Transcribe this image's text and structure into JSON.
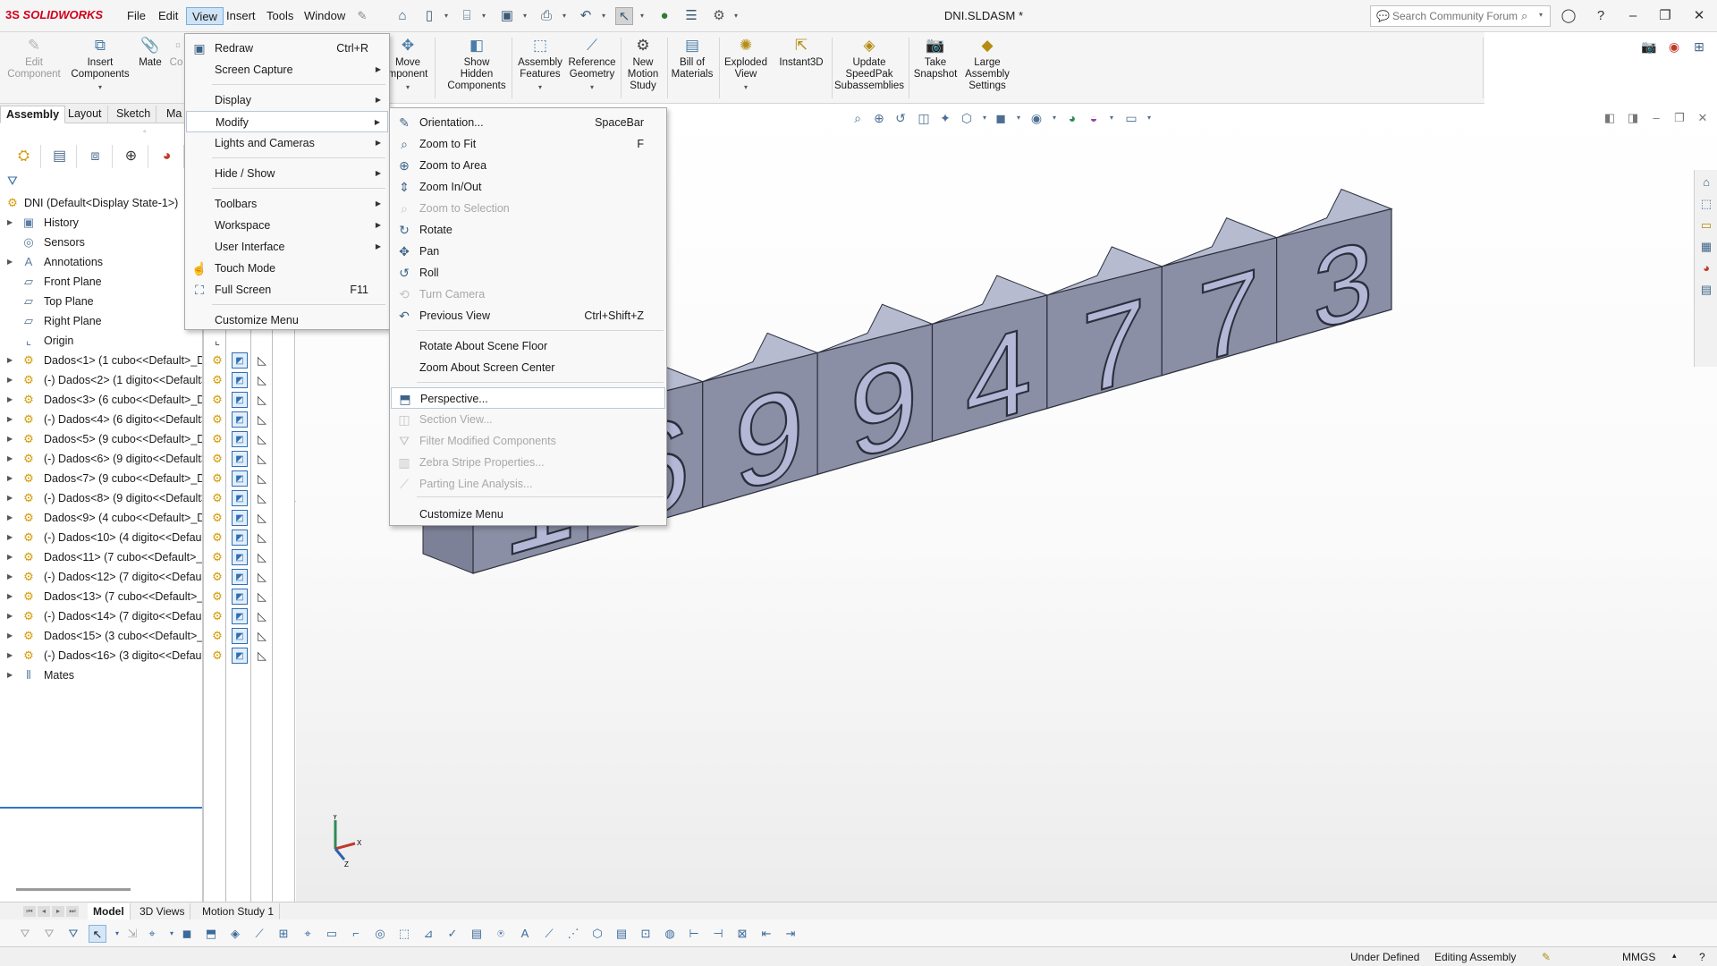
{
  "app": {
    "logo_prefix": "3S",
    "logo_name": "SOLIDWORKS",
    "document_title": "DNI.SLDASM *",
    "pin_icon": "pin-icon"
  },
  "menubar": [
    "File",
    "Edit",
    "View",
    "Insert",
    "Tools",
    "Window"
  ],
  "search": {
    "placeholder": "Search Community Forum"
  },
  "command_manager": [
    {
      "line1": "Edit",
      "line2": "Component",
      "icon": "edit-component-icon",
      "enabled": false
    },
    {
      "line1": "Insert",
      "line2": "Components",
      "icon": "insert-components-icon",
      "enabled": true
    },
    {
      "line1": "Mate",
      "line2": "",
      "icon": "mate-icon",
      "enabled": true
    },
    {
      "line1": "Co",
      "line2": "Co",
      "icon": "component-icon",
      "enabled": false
    },
    {
      "line1": "Move",
      "line2": "mponent",
      "icon": "move-component-icon",
      "enabled": true
    },
    {
      "line1": "Show",
      "line2": "Hidden",
      "line3": "Components",
      "icon": "show-hidden-icon",
      "enabled": true
    },
    {
      "line1": "Assembly",
      "line2": "Features",
      "icon": "assembly-features-icon",
      "enabled": true
    },
    {
      "line1": "Reference",
      "line2": "Geometry",
      "icon": "reference-geometry-icon",
      "enabled": true
    },
    {
      "line1": "New",
      "line2": "Motion",
      "line3": "Study",
      "icon": "motion-study-icon",
      "enabled": true
    },
    {
      "line1": "Bill of",
      "line2": "Materials",
      "icon": "bom-icon",
      "enabled": true
    },
    {
      "line1": "Exploded",
      "line2": "View",
      "icon": "exploded-view-icon",
      "enabled": true
    },
    {
      "line1": "Instant3D",
      "line2": "",
      "icon": "instant3d-icon",
      "enabled": true
    },
    {
      "line1": "Update",
      "line2": "SpeedPak",
      "line3": "Subassemblies",
      "icon": "speedpak-icon",
      "enabled": true
    },
    {
      "line1": "Take",
      "line2": "Snapshot",
      "icon": "snapshot-icon",
      "enabled": true
    },
    {
      "line1": "Large",
      "line2": "Assembly",
      "line3": "Settings",
      "icon": "large-assembly-icon",
      "enabled": true
    }
  ],
  "cm_tabs": [
    "Assembly",
    "Layout",
    "Sketch",
    "Ma"
  ],
  "tree": {
    "root": "DNI  (Default<Display State-1>)",
    "items": [
      {
        "label": "History",
        "icon": "history-folder-icon",
        "expand": true
      },
      {
        "label": "Sensors",
        "icon": "sensors-folder-icon",
        "expand": false
      },
      {
        "label": "Annotations",
        "icon": "annotations-folder-icon",
        "expand": true
      },
      {
        "label": "Front Plane",
        "icon": "plane-icon",
        "expand": false
      },
      {
        "label": "Top Plane",
        "icon": "plane-icon",
        "expand": false
      },
      {
        "label": "Right Plane",
        "icon": "plane-icon",
        "expand": false
      },
      {
        "label": "Origin",
        "icon": "origin-icon",
        "expand": false
      },
      {
        "label": "Dados<1> (1 cubo<<Default>_Di",
        "icon": "part-icon",
        "expand": true
      },
      {
        "label": "(-) Dados<2> (1 digito<<Default>",
        "icon": "part-icon",
        "expand": true
      },
      {
        "label": "Dados<3> (6 cubo<<Default>_Di",
        "icon": "part-icon",
        "expand": true
      },
      {
        "label": "(-) Dados<4> (6 digito<<Default>",
        "icon": "part-icon",
        "expand": true
      },
      {
        "label": "Dados<5> (9 cubo<<Default>_Di",
        "icon": "part-icon",
        "expand": true
      },
      {
        "label": "(-) Dados<6> (9 digito<<Default>",
        "icon": "part-icon",
        "expand": true
      },
      {
        "label": "Dados<7> (9 cubo<<Default>_Di",
        "icon": "part-icon",
        "expand": true
      },
      {
        "label": "(-) Dados<8> (9 digito<<Default>",
        "icon": "part-icon",
        "expand": true
      },
      {
        "label": "Dados<9> (4 cubo<<Default>_Di",
        "icon": "part-icon",
        "expand": true
      },
      {
        "label": "(-) Dados<10> (4 digito<<Default",
        "icon": "part-icon",
        "expand": true
      },
      {
        "label": "Dados<11> (7 cubo<<Default>_D",
        "icon": "part-icon",
        "expand": true
      },
      {
        "label": "(-) Dados<12> (7 digito<<Default",
        "icon": "part-icon",
        "expand": true
      },
      {
        "label": "Dados<13> (7 cubo<<Default>_D",
        "icon": "part-icon",
        "expand": true
      },
      {
        "label": "(-) Dados<14> (7 digito<<Default",
        "icon": "part-icon",
        "expand": true
      },
      {
        "label": "Dados<15> (3 cubo<<Default>_D",
        "icon": "part-icon",
        "expand": true
      },
      {
        "label": "(-) Dados<16> (3 digito<<Default",
        "icon": "part-icon",
        "expand": true
      },
      {
        "label": "Mates",
        "icon": "mates-icon",
        "expand": true
      }
    ]
  },
  "model": {
    "digits": [
      "1",
      "6",
      "9",
      "9",
      "4",
      "7",
      "7",
      "3"
    ],
    "block_color": "#8b8fa5",
    "block_top_color": "#b7bbd0",
    "digit_color": "#b4b8d6"
  },
  "view_menu": [
    {
      "label": "Redraw",
      "shortcut": "Ctrl+R",
      "icon": "redraw-icon",
      "submenu": false
    },
    {
      "label": "Screen Capture",
      "shortcut": "",
      "icon": "",
      "submenu": true
    },
    {
      "label": "Display",
      "shortcut": "",
      "icon": "",
      "submenu": true
    },
    {
      "label": "Modify",
      "shortcut": "",
      "icon": "",
      "submenu": true,
      "highlighted": true
    },
    {
      "label": "Lights and Cameras",
      "shortcut": "",
      "icon": "",
      "submenu": true
    },
    {
      "label": "Hide / Show",
      "shortcut": "",
      "icon": "",
      "submenu": true
    },
    {
      "label": "Toolbars",
      "shortcut": "",
      "icon": "",
      "submenu": true
    },
    {
      "label": "Workspace",
      "shortcut": "",
      "icon": "",
      "submenu": true
    },
    {
      "label": "User Interface",
      "shortcut": "",
      "icon": "",
      "submenu": true
    },
    {
      "label": "Touch Mode",
      "shortcut": "",
      "icon": "touch-mode-icon",
      "submenu": false
    },
    {
      "label": "Full Screen",
      "shortcut": "F11",
      "icon": "full-screen-icon",
      "submenu": false
    },
    {
      "label": "Customize Menu",
      "shortcut": "",
      "icon": "",
      "submenu": false
    }
  ],
  "modify_menu": [
    {
      "label": "Orientation...",
      "shortcut": "SpaceBar",
      "icon": "orientation-icon",
      "enabled": true
    },
    {
      "label": "Zoom to Fit",
      "shortcut": "F",
      "icon": "zoom-to-fit-icon",
      "enabled": true
    },
    {
      "label": "Zoom to Area",
      "shortcut": "",
      "icon": "zoom-to-area-icon",
      "enabled": true
    },
    {
      "label": "Zoom In/Out",
      "shortcut": "",
      "icon": "zoom-in-out-icon",
      "enabled": true
    },
    {
      "label": "Zoom to Selection",
      "shortcut": "",
      "icon": "zoom-to-selection-icon",
      "enabled": false
    },
    {
      "label": "Rotate",
      "shortcut": "",
      "icon": "rotate-icon",
      "enabled": true
    },
    {
      "label": "Pan",
      "shortcut": "",
      "icon": "pan-icon",
      "enabled": true
    },
    {
      "label": "Roll",
      "shortcut": "",
      "icon": "roll-icon",
      "enabled": true
    },
    {
      "label": "Turn Camera",
      "shortcut": "",
      "icon": "turn-camera-icon",
      "enabled": false
    },
    {
      "label": "Previous View",
      "shortcut": "Ctrl+Shift+Z",
      "icon": "previous-view-icon",
      "enabled": true
    },
    {
      "label": "Rotate About Scene Floor",
      "shortcut": "",
      "icon": "",
      "enabled": true
    },
    {
      "label": "Zoom About Screen Center",
      "shortcut": "",
      "icon": "",
      "enabled": true
    },
    {
      "label": "Perspective...",
      "shortcut": "",
      "icon": "perspective-icon",
      "enabled": true,
      "highlighted": true
    },
    {
      "label": "Section View...",
      "shortcut": "",
      "icon": "section-view-icon",
      "enabled": false
    },
    {
      "label": "Filter Modified Components",
      "shortcut": "",
      "icon": "filter-modified-icon",
      "enabled": false
    },
    {
      "label": "Zebra Stripe Properties...",
      "shortcut": "",
      "icon": "zebra-stripe-icon",
      "enabled": false
    },
    {
      "label": "Parting Line Analysis...",
      "shortcut": "",
      "icon": "parting-line-icon",
      "enabled": false
    },
    {
      "label": "Customize Menu",
      "shortcut": "",
      "icon": "",
      "enabled": true
    }
  ],
  "bottom_tabs": [
    "Model",
    "3D Views",
    "Motion Study 1"
  ],
  "status": {
    "state": "Under Defined",
    "mode": "Editing Assembly",
    "units": "MMGS"
  }
}
